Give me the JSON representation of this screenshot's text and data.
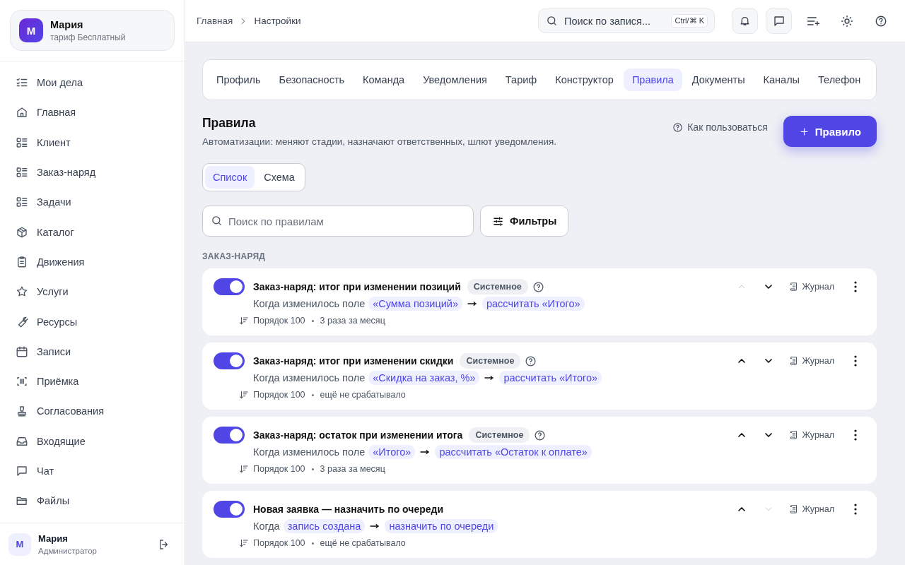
{
  "sidebar": {
    "account": {
      "avatar": "М",
      "name": "Мария",
      "plan": "тариф Бесплатный"
    },
    "items": [
      {
        "label": "Мои дела",
        "selected": false
      },
      {
        "label": "Главная",
        "selected": false
      },
      {
        "label": "Клиент",
        "selected": false
      },
      {
        "label": "Заказ-наряд",
        "selected": false
      },
      {
        "label": "Задачи",
        "selected": false
      },
      {
        "label": "Каталог",
        "selected": false
      },
      {
        "label": "Движения",
        "selected": false
      },
      {
        "label": "Услуги",
        "selected": false
      },
      {
        "label": "Ресурсы",
        "selected": false
      },
      {
        "label": "Записи",
        "selected": false
      },
      {
        "label": "Приёмка",
        "selected": false
      },
      {
        "label": "Согласования",
        "selected": false
      },
      {
        "label": "Входящие",
        "selected": false
      },
      {
        "label": "Чат",
        "selected": false
      },
      {
        "label": "Файлы",
        "selected": false
      }
    ],
    "user": {
      "avatar": "М",
      "name": "Мария",
      "role": "Администратор"
    }
  },
  "header": {
    "breadcrumbs": [
      "Главная",
      "Настройки"
    ],
    "search": {
      "placeholder": "Поиск по запися...",
      "shortcut": "Ctrl/⌘ K"
    }
  },
  "tabs": [
    {
      "label": "Профиль",
      "selected": false
    },
    {
      "label": "Безопасность",
      "selected": false
    },
    {
      "label": "Команда",
      "selected": false
    },
    {
      "label": "Уведомления",
      "selected": false
    },
    {
      "label": "Тариф",
      "selected": false
    },
    {
      "label": "Конструктор",
      "selected": false
    },
    {
      "label": "Правила",
      "selected": true
    },
    {
      "label": "Документы",
      "selected": false
    },
    {
      "label": "Каналы",
      "selected": false
    },
    {
      "label": "Телефон",
      "selected": false
    }
  ],
  "page": {
    "title": "Правила",
    "subtitle": "Автоматизации: меняют стадии, назначают ответственных, шлют уведомления.",
    "help_link": "Как пользоваться",
    "add_button": "Правило",
    "views": [
      {
        "label": "Список",
        "selected": true
      },
      {
        "label": "Схема",
        "selected": false
      }
    ],
    "search": {
      "placeholder": "Поиск по правилам"
    },
    "filters_button": "Фильтры",
    "section": "ЗАКАЗ-НАРЯД"
  },
  "rules": [
    {
      "title": "Заказ-наряд: итог при изменении позиций",
      "badge": "Системное",
      "enabled": true,
      "condition": "Когда изменилось поле",
      "trigger": "«Сумма позиций»",
      "action": "рассчитать «Итого»",
      "order": "Порядок 100",
      "runs": "3 раза за месяц",
      "up_disabled": true,
      "down_disabled": false,
      "log_button": "Журнал"
    },
    {
      "title": "Заказ-наряд: итог при изменении скидки",
      "badge": "Системное",
      "enabled": true,
      "condition": "Когда изменилось поле",
      "trigger": "«Скидка на заказ, %»",
      "action": "рассчитать «Итого»",
      "order": "Порядок 100",
      "runs": "ещё не срабатывало",
      "up_disabled": false,
      "down_disabled": false,
      "log_button": "Журнал"
    },
    {
      "title": "Заказ-наряд: остаток при изменении итога",
      "badge": "Системное",
      "enabled": true,
      "condition": "Когда изменилось поле",
      "trigger": "«Итого»",
      "action": "рассчитать «Остаток к оплате»",
      "order": "Порядок 100",
      "runs": "3 раза за месяц",
      "up_disabled": false,
      "down_disabled": false,
      "log_button": "Журнал"
    },
    {
      "title": "Новая заявка — назначить по очереди",
      "enabled": true,
      "condition": "Когда",
      "trigger": "запись создана",
      "action": "назначить по очереди",
      "order": "Порядок 100",
      "runs": "ещё не срабатывало",
      "up_disabled": false,
      "down_disabled": true,
      "log_button": "Журнал"
    }
  ]
}
